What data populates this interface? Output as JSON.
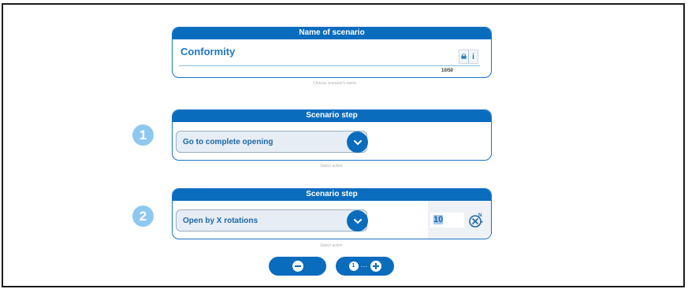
{
  "name_card": {
    "header": "Name of scenario",
    "value": "Conformity",
    "counter": "10/50",
    "caption": "Choose scenario's name",
    "icons": [
      "skull-icon",
      "info-icon"
    ]
  },
  "steps": [
    {
      "number": "1",
      "header": "Scenario step",
      "action": "Go to complete opening",
      "caption": "Select action"
    },
    {
      "number": "2",
      "header": "Scenario step",
      "action": "Open by X rotations",
      "rotations": "10",
      "caption": "Select action"
    }
  ],
  "controls": {
    "remove_icon": "minus-icon",
    "add_icon": "plus-icon",
    "add_count": "1",
    "add_dots": "···"
  },
  "colors": {
    "primary": "#0a6cbd",
    "badge": "#8ec8f1",
    "text_accent": "#1d78c4"
  }
}
